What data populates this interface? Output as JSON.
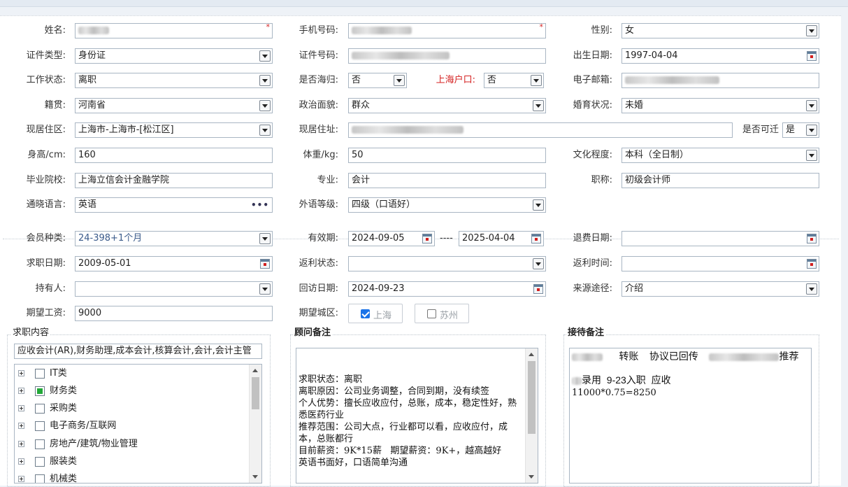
{
  "form": {
    "name": {
      "label": "姓名:",
      "value": ""
    },
    "phone": {
      "label": "手机号码:",
      "value": ""
    },
    "gender": {
      "label": "性别:",
      "value": "女"
    },
    "id_type": {
      "label": "证件类型:",
      "value": "身份证"
    },
    "id_no": {
      "label": "证件号码:",
      "value": ""
    },
    "birth": {
      "label": "出生日期:",
      "value": "1997-04-04"
    },
    "work_status": {
      "label": "工作状态:",
      "value": "离职"
    },
    "returnee": {
      "label": "是否海归:",
      "value": "否"
    },
    "shanghai_hukou": {
      "label": "上海户口:",
      "value": "否"
    },
    "email": {
      "label": "电子邮箱:",
      "value": ""
    },
    "native_place": {
      "label": "籍贯:",
      "value": "河南省"
    },
    "political": {
      "label": "政治面貌:",
      "value": "群众"
    },
    "marital": {
      "label": "婚育状况:",
      "value": "未婚"
    },
    "residence_area": {
      "label": "现居住区:",
      "value": "上海市-上海市-[松江区]"
    },
    "address": {
      "label": "现居住址:",
      "value": ""
    },
    "relocate": {
      "label": "是否可迁",
      "value": "是"
    },
    "height": {
      "label": "身高/cm:",
      "value": "160"
    },
    "weight": {
      "label": "体重/kg:",
      "value": "50"
    },
    "education": {
      "label": "文化程度:",
      "value": "本科（全日制）"
    },
    "school": {
      "label": "毕业院校:",
      "value": "上海立信会计金融学院"
    },
    "major": {
      "label": "专业:",
      "value": "会计"
    },
    "title": {
      "label": "职称:",
      "value": "初级会计师"
    },
    "languages": {
      "label": "通晓语言:",
      "value": "英语",
      "more": "•••"
    },
    "foreign_level": {
      "label": "外语等级:",
      "value": "四级（口语好）"
    }
  },
  "member": {
    "type": {
      "label": "会员种类:",
      "value": "24-398+1个月"
    },
    "valid": {
      "label": "有效期:",
      "from": "2024-09-05",
      "sep": "----",
      "to": "2025-04-04"
    },
    "refund_date": {
      "label": "退费日期:",
      "value": ""
    },
    "job_date": {
      "label": "求职日期:",
      "value": "2009-05-01"
    },
    "rebate_status": {
      "label": "返利状态:",
      "value": ""
    },
    "rebate_time": {
      "label": "返利时间:",
      "value": ""
    },
    "holder": {
      "label": "持有人:",
      "value": ""
    },
    "visit_date": {
      "label": "回访日期:",
      "value": "2024-09-23"
    },
    "source": {
      "label": "来源途径:",
      "value": "介绍"
    },
    "salary": {
      "label": "期望工资:",
      "value": "9000"
    },
    "city_label": "期望城区:",
    "cities": [
      {
        "label": "上海",
        "checked": true
      },
      {
        "label": "苏州",
        "checked": false
      }
    ]
  },
  "job_content": {
    "legend": "求职内容",
    "selected": "应收会计(AR),财务助理,成本会计,核算会计,会计,会计主管",
    "tree": [
      {
        "label": "IT类",
        "state": "unchecked"
      },
      {
        "label": "财务类",
        "state": "partial"
      },
      {
        "label": "采购类",
        "state": "unchecked"
      },
      {
        "label": "电子商务/互联网",
        "state": "unchecked"
      },
      {
        "label": "房地产/建筑/物业管理",
        "state": "unchecked"
      },
      {
        "label": "服装类",
        "state": "unchecked"
      },
      {
        "label": "机械类",
        "state": "unchecked"
      }
    ]
  },
  "advisor_note": {
    "legend": "顾问备注",
    "text": "求职状态：离职\n离职原因：公司业务调整，合同到期，没有续签\n个人优势：擅长应收应付，总账，成本，稳定性好，熟悉医药行业\n推荐范围：公司大点，行业都可以看，应收应付，成本，总账都行\n目前薪资：9K*15薪   期望薪资：9K+，越高越好\n英语书面好，口语简单沟通"
  },
  "reception_note": {
    "legend": "接待备注",
    "line1_a": "转账",
    "line1_b": "协议已回传",
    "line1_c": "推荐",
    "line2": "录用  9-23入职  应收",
    "line3": "11000*0.75=8250"
  },
  "colors": {
    "required": "#d42020",
    "accent": "#1a73e8",
    "tree_partial": "#22a838"
  }
}
